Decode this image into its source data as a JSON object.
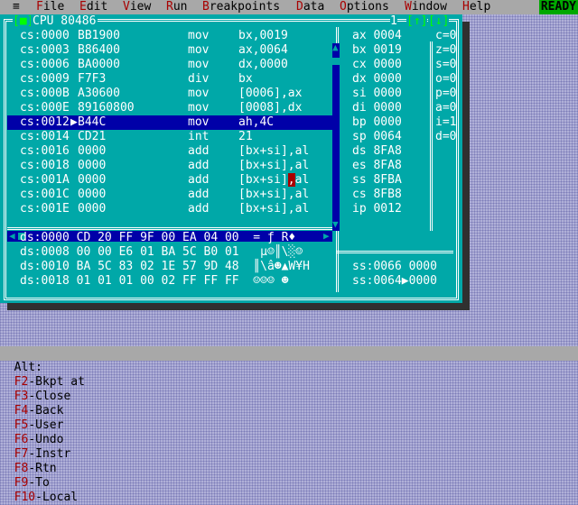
{
  "menu": {
    "system_icon": "≡",
    "items": [
      {
        "hot": "F",
        "rest": "ile"
      },
      {
        "hot": "E",
        "rest": "dit"
      },
      {
        "hot": "V",
        "rest": "iew"
      },
      {
        "hot": "R",
        "rest": "un"
      },
      {
        "hot": "B",
        "rest": "reakpoints"
      },
      {
        "hot": "D",
        "rest": "ata"
      },
      {
        "hot": "O",
        "rest": "ptions"
      },
      {
        "hot": "W",
        "rest": "indow"
      },
      {
        "hot": "H",
        "rest": "elp"
      }
    ],
    "status_indicator": "READY"
  },
  "cpu_window": {
    "close_box": "[■]",
    "title": "CPU 80486",
    "window_number": "1",
    "zoom_buttons": [
      "[↑]",
      "[↓]"
    ],
    "code": [
      {
        "addr": "cs:0000",
        "bytes": "BB1900",
        "op": "mov",
        "args": "bx,0019"
      },
      {
        "addr": "cs:0003",
        "bytes": "B86400",
        "op": "mov",
        "args": "ax,0064"
      },
      {
        "addr": "cs:0006",
        "bytes": "BA0000",
        "op": "mov",
        "args": "dx,0000"
      },
      {
        "addr": "cs:0009",
        "bytes": "F7F3",
        "op": "div",
        "args": "bx"
      },
      {
        "addr": "cs:000B",
        "bytes": "A30600",
        "op": "mov",
        "args": "[0006],ax"
      },
      {
        "addr": "cs:000E",
        "bytes": "89160800",
        "op": "mov",
        "args": "[0008],dx"
      },
      {
        "addr": "cs:0012",
        "bytes": "B44C",
        "op": "mov",
        "args": "ah,4C",
        "current": true,
        "marker": "▶"
      },
      {
        "addr": "cs:0014",
        "bytes": "CD21",
        "op": "int",
        "args": "21"
      },
      {
        "addr": "cs:0016",
        "bytes": "0000",
        "op": "add",
        "args": "[bx+si],al"
      },
      {
        "addr": "cs:0018",
        "bytes": "0000",
        "op": "add",
        "args": "[bx+si],al"
      },
      {
        "addr": "cs:001A",
        "bytes": "0000",
        "op": "add",
        "args_pre": "[bx+si]",
        "args_cursor": ",",
        "args_post": "al"
      },
      {
        "addr": "cs:001C",
        "bytes": "0000",
        "op": "add",
        "args": "[bx+si],al"
      },
      {
        "addr": "cs:001E",
        "bytes": "0000",
        "op": "add",
        "args": "[bx+si],al"
      }
    ],
    "registers": [
      {
        "name": "ax",
        "value": "0004"
      },
      {
        "name": "bx",
        "value": "0019"
      },
      {
        "name": "cx",
        "value": "0000"
      },
      {
        "name": "dx",
        "value": "0000"
      },
      {
        "name": "si",
        "value": "0000"
      },
      {
        "name": "di",
        "value": "0000"
      },
      {
        "name": "bp",
        "value": "0000"
      },
      {
        "name": "sp",
        "value": "0064"
      },
      {
        "name": "ds",
        "value": "8FA8"
      },
      {
        "name": "es",
        "value": "8FA8"
      },
      {
        "name": "ss",
        "value": "8FBA"
      },
      {
        "name": "cs",
        "value": "8FB8"
      },
      {
        "name": "ip",
        "value": "0012"
      }
    ],
    "flags": [
      {
        "name": "c",
        "value": "0"
      },
      {
        "name": "z",
        "value": "0"
      },
      {
        "name": "s",
        "value": "0"
      },
      {
        "name": "o",
        "value": "0"
      },
      {
        "name": "p",
        "value": "0"
      },
      {
        "name": "a",
        "value": "0"
      },
      {
        "name": "i",
        "value": "1"
      },
      {
        "name": "d",
        "value": "0"
      }
    ],
    "dump": [
      {
        "addr": "ds:0000",
        "bytes": "CD 20 FF 9F 00 EA 04 00",
        "ascii": "= ƒ R♦"
      },
      {
        "addr": "ds:0008",
        "bytes": "00 00 E6 01 BA 5C B0 01",
        "ascii": "µ☺║\\░☺"
      },
      {
        "addr": "ds:0010",
        "bytes": "BA 5C 83 02 1E 57 9D 48",
        "ascii": "║\\â☻▲W¥H"
      },
      {
        "addr": "ds:0018",
        "bytes": "01 01 01 00 02 FF FF FF",
        "ascii": "☺☺☺ ☻"
      }
    ],
    "stack": [
      {
        "addr": "ss:0066",
        "sep": " ",
        "value": "0000"
      },
      {
        "addr": "ss:0064",
        "sep": "▶",
        "value": "0000"
      }
    ]
  },
  "statusbar": {
    "prefix": "Alt:",
    "keys": [
      {
        "key": "F2",
        "label": "-Bkpt at"
      },
      {
        "key": "F3",
        "label": "-Close"
      },
      {
        "key": "F4",
        "label": "-Back"
      },
      {
        "key": "F5",
        "label": "-User"
      },
      {
        "key": "F6",
        "label": "-Undo"
      },
      {
        "key": "F7",
        "label": "-Instr"
      },
      {
        "key": "F8",
        "label": "-Rtn"
      },
      {
        "key": "F9",
        "label": "-To"
      },
      {
        "key": "F10",
        "label": "-Local"
      }
    ]
  }
}
